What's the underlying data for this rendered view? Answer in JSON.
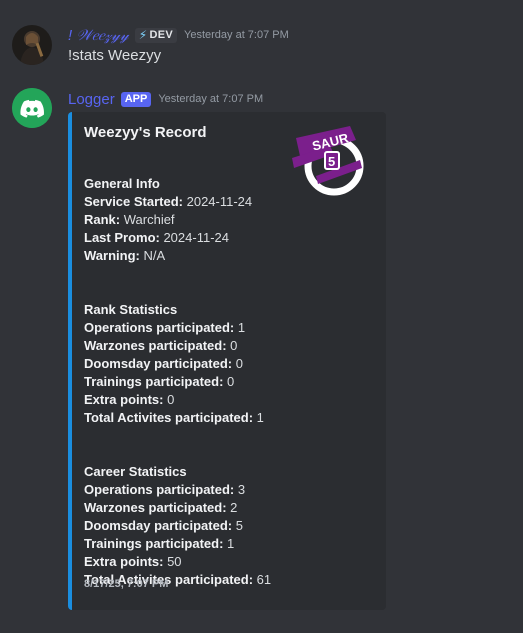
{
  "message1": {
    "username": "! 𝒲𝑒𝑒𝓏𝓎𝓎",
    "badge": "DEV",
    "timestamp": "Yesterday at 7:07 PM",
    "content": "!stats Weezyy"
  },
  "message2": {
    "username": "Logger",
    "badge": "APP",
    "timestamp": "Yesterday at 7:07 PM",
    "embed": {
      "title": "Weezyy's Record",
      "thumbnail_text": "SAUR",
      "thumbnail_num": "5",
      "sections": {
        "general": {
          "heading": "General Info",
          "service_label": "Service Started:",
          "service_value": " 2024-11-24",
          "rank_label": "Rank:",
          "rank_value": " Warchief",
          "promo_label": "Last Promo:",
          "promo_value": " 2024-11-24",
          "warning_label": "Warning:",
          "warning_value": " N/A"
        },
        "rank": {
          "heading": "Rank Statistics",
          "ops_label": "Operations participated:",
          "ops_value": " 1",
          "war_label": "Warzones participated:",
          "war_value": " 0",
          "dooms_label": "Doomsday participated:",
          "dooms_value": " 0",
          "train_label": "Trainings participated:",
          "train_value": " 0",
          "extra_label": "Extra points:",
          "extra_value": " 0",
          "total_label": "Total Activites participated:",
          "total_value": " 1"
        },
        "career": {
          "heading": "Career Statistics",
          "ops_label": "Operations participated:",
          "ops_value": " 3",
          "war_label": "Warzones participated:",
          "war_value": " 2",
          "dooms_label": "Doomsday participated:",
          "dooms_value": " 5",
          "train_label": "Trainings participated:",
          "train_value": " 1",
          "extra_label": "Extra points:",
          "extra_value": " 50",
          "total_label": "Total Activites participated:",
          "total_value": " 61"
        }
      },
      "footer": "8/17/25, 7:07 PM"
    }
  },
  "colors": {
    "background": "#313338",
    "embed_bg": "#2b2d31",
    "embed_accent": "#1a8ee0",
    "bot_name": "#5865f2",
    "app_badge": "#5865f2",
    "discord_avatar": "#23a559",
    "thumb_purple": "#7b1f8c"
  },
  "icons": {
    "user_avatar": "user-avatar-photo",
    "bot_avatar": "discord-logo-icon",
    "dev_badge_icon": "lightning-bolt-icon"
  }
}
